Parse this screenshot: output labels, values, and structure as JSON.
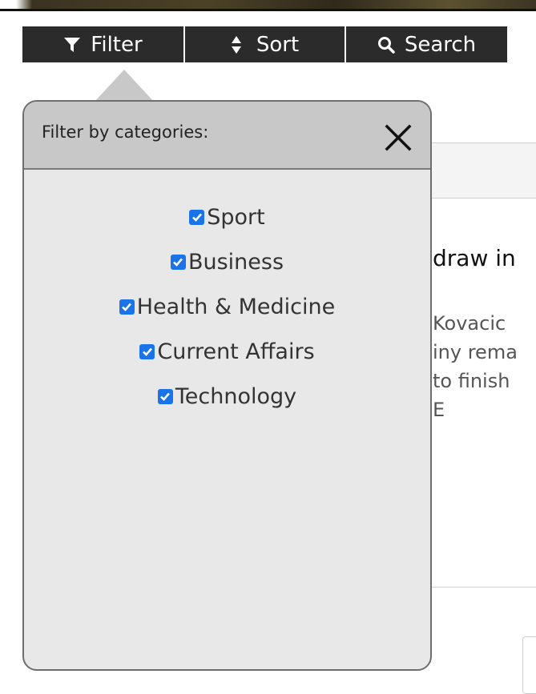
{
  "toolbar": {
    "filter_label": "Filter",
    "sort_label": "Sort",
    "search_label": "Search"
  },
  "article": {
    "title_fragment": "draw in",
    "body_lines": [
      "Kovacic",
      "iny rema",
      "to finish",
      "E"
    ]
  },
  "filter_popover": {
    "title": "Filter by categories:",
    "categories": [
      {
        "label": "Sport",
        "checked": true
      },
      {
        "label": "Business",
        "checked": true
      },
      {
        "label": "Health & Medicine",
        "checked": true
      },
      {
        "label": "Current Affairs",
        "checked": true
      },
      {
        "label": "Technology",
        "checked": true
      }
    ]
  },
  "icons": {
    "filter": "filter-funnel-icon",
    "sort": "sort-updown-icon",
    "search": "magnifier-icon",
    "close": "close-x-icon",
    "checkbox": "checkbox-checked-icon"
  },
  "colors": {
    "toolbar_bg": "#2b2b2b",
    "popover_bg": "#e8e8e8",
    "popover_header_bg": "#c8c8c8",
    "checkbox_accent": "#1a73e8"
  }
}
